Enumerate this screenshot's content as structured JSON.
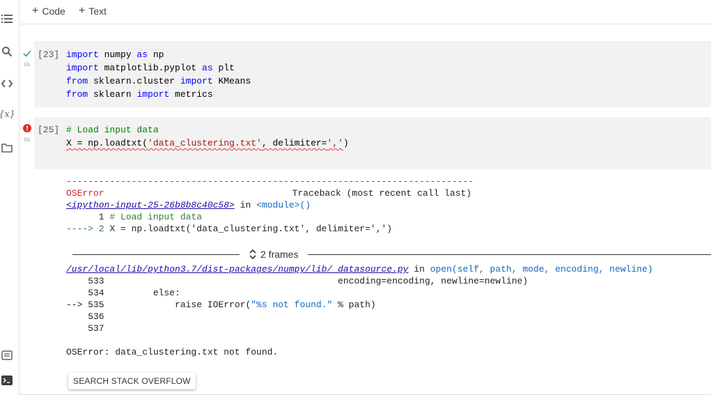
{
  "toolbar": {
    "add_code": "Code",
    "add_text": "Text"
  },
  "sidebar": {
    "icons": [
      "table-of-contents-icon",
      "search-icon",
      "code-snippets-icon",
      "variables-icon",
      "files-icon",
      "command-palette-icon",
      "terminal-icon"
    ],
    "variables_label": "{x}"
  },
  "cell1": {
    "exec_count": "[23]",
    "time": "0s",
    "status": "success",
    "lines": [
      {
        "kw1": "import",
        "rest1": " numpy ",
        "kw2": "as",
        "rest2": " np"
      },
      {
        "kw1": "import",
        "rest1": " matplotlib.pyplot ",
        "kw2": "as",
        "rest2": " plt"
      },
      {
        "kw1": "from",
        "rest1": " sklearn.cluster ",
        "kw2": "import",
        "rest2": " KMeans"
      },
      {
        "kw1": "from",
        "rest1": " sklearn ",
        "kw2": "import",
        "rest2": " metrics"
      }
    ]
  },
  "cell2": {
    "exec_count": "[25]",
    "time": "0s",
    "status": "error",
    "comment": "# Load input data",
    "code_pre": "X = np.loadtxt(",
    "code_str1": "'data_clustering.txt'",
    "code_mid": ", delimiter=",
    "code_str2": "','",
    "code_post": ")"
  },
  "output": {
    "dashes": "---------------------------------------------------------------------------",
    "error_name": "OSError",
    "traceback_label": "Traceback (most recent call last)",
    "input_link": "<ipython-input-25-26b8b8c40c58>",
    "in_text": " in ",
    "module_text": "<module>()",
    "line1": "      1 # Load input data",
    "line2": "----> 2 X = np.loadtxt('data_clustering.txt', delimiter=',')",
    "frames_label": "2 frames",
    "file_link": "/usr/local/lib/python3.7/dist-packages/numpy/lib/_datasource.py",
    "in_open": " in ",
    "open_sig": "open(self, path, mode, encoding, newline)",
    "l533": "    533                                           encoding=encoding, newline=newline)",
    "l534": "    534         else:",
    "l535_pre": "--> 535             raise IOError(",
    "l535_str": "\"%s not found.\"",
    "l535_post": " % path)",
    "l536": "    536",
    "l537": "    537",
    "final_error": "OSError: data_clustering.txt not found.",
    "so_button": "SEARCH STACK OVERFLOW"
  },
  "colors": {
    "keyword": "#0000ff",
    "comment": "#008000",
    "string": "#a31515",
    "error": "#c62828",
    "success": "#34a853",
    "cell_bg": "#f2f2f2"
  }
}
